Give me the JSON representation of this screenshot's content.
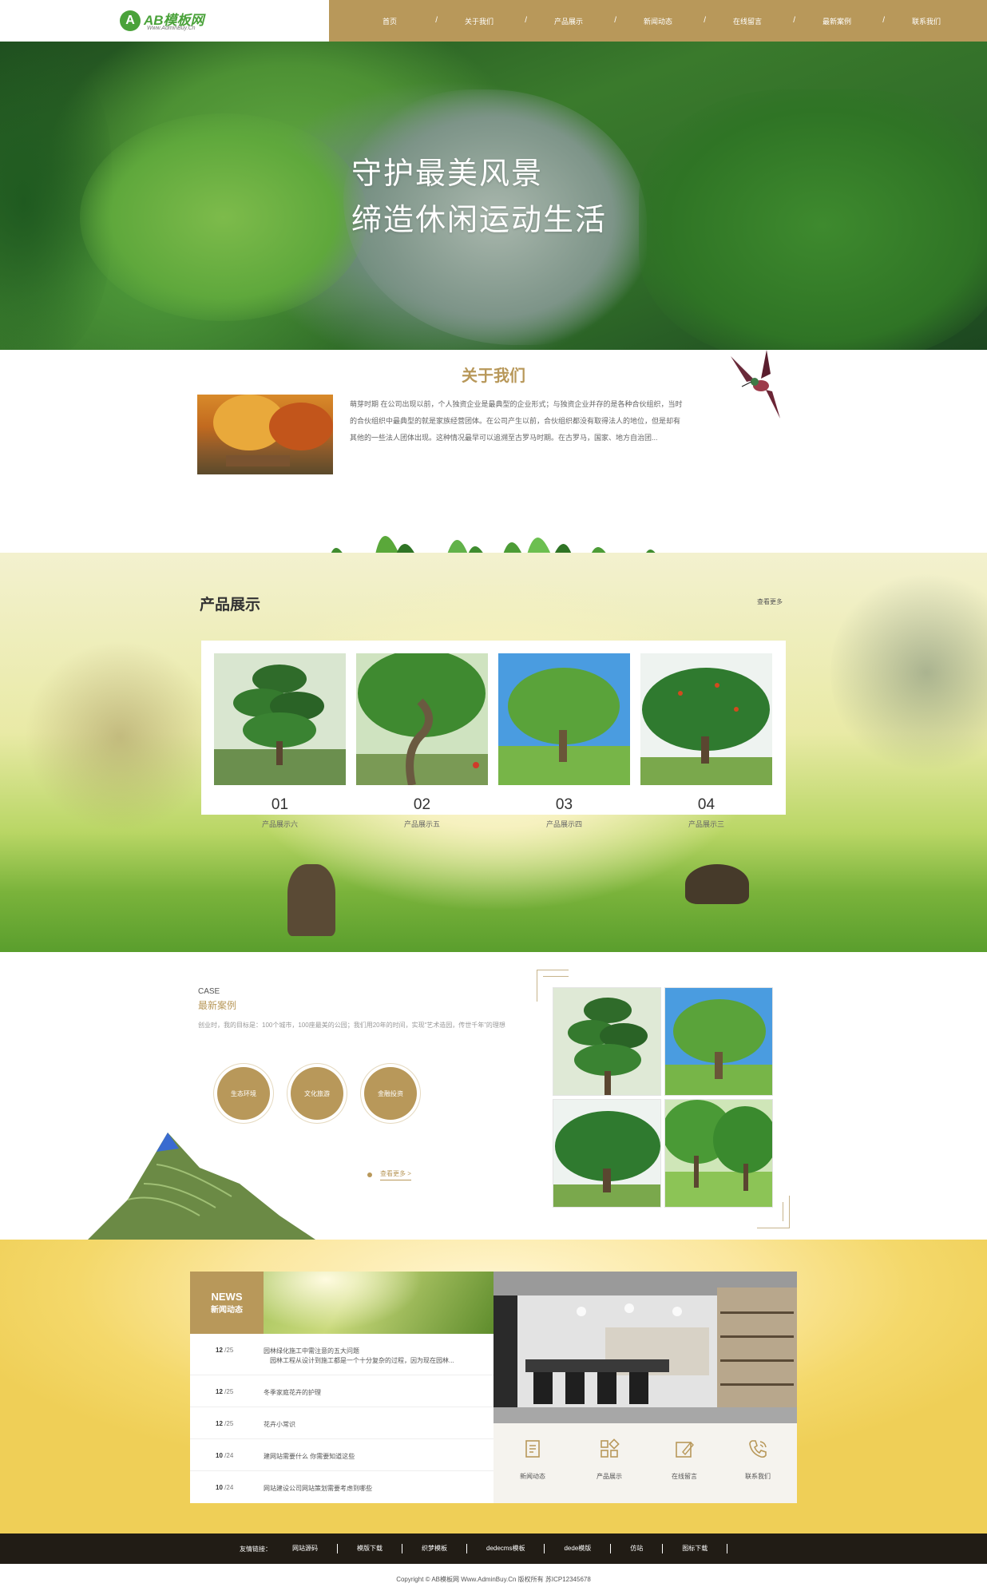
{
  "header": {
    "logo_mark": "A",
    "logo_text": "AB模板网",
    "logo_sub": "Www.AdminBuy.Cn",
    "accent": "#b8985a",
    "nav": [
      "首页",
      "关于我们",
      "产品展示",
      "新闻动态",
      "在线留言",
      "最新案例",
      "联系我们"
    ]
  },
  "hero": {
    "line1": "守护最美风景",
    "line2": "缔造休闲运动生活",
    "dots": 2,
    "active_dot": 1
  },
  "about": {
    "title": "关于我们",
    "text": "萌芽时期 在公司出现以前，个人独资企业是最典型的企业形式；与独资企业并存的是各种合伙组织，当时的合伙组织中最典型的就是家族经营团体。在公司产生以前，合伙组织都没有取得法人的地位，但是却有其他的一些法人团体出现。这种情况最早可以追溯至古罗马时期。在古罗马，国家、地方自治团..."
  },
  "products": {
    "title": "产品展示",
    "more": "查看更多",
    "items": [
      {
        "num": "01",
        "label": "产品展示六"
      },
      {
        "num": "02",
        "label": "产品展示五"
      },
      {
        "num": "03",
        "label": "产品展示四"
      },
      {
        "num": "04",
        "label": "产品展示三"
      }
    ]
  },
  "cases": {
    "en": "CASE",
    "cn": "最新案例",
    "desc": "创业时，我的目标是：100个城市，100座最美的公园；我们用20年的时间，实现“艺术造园，传世千年”的理想",
    "circles": [
      "生态环境",
      "文化旅游",
      "金融投资"
    ],
    "more": "查看更多 >"
  },
  "news": {
    "badge_en": "NEWS",
    "badge_cn": "新闻动态",
    "items": [
      {
        "day": "12",
        "month": "/25",
        "title": "园林绿化施工中需注意的五大问题",
        "sub": "园林工程从设计到施工都是一个十分复杂的过程，因为现在园林..."
      },
      {
        "day": "12",
        "month": "/25",
        "title": "冬季家庭花卉的护理",
        "sub": ""
      },
      {
        "day": "12",
        "month": "/25",
        "title": "花卉小常识",
        "sub": ""
      },
      {
        "day": "10",
        "month": "/24",
        "title": "建网站需要什么 你需要知道这些",
        "sub": ""
      },
      {
        "day": "10",
        "month": "/24",
        "title": "网站建设公司网站策划需要考虑到哪些",
        "sub": ""
      }
    ],
    "quick": [
      {
        "icon": "document-icon",
        "label": "新闻动态"
      },
      {
        "icon": "grid-icon",
        "label": "产品展示"
      },
      {
        "icon": "edit-icon",
        "label": "在线留言"
      },
      {
        "icon": "phone-icon",
        "label": "联系我们"
      }
    ]
  },
  "footer": {
    "links_label": "友情链接：",
    "links": [
      "网站源码",
      "模版下载",
      "织梦模板",
      "dedecms模板",
      "dede模版",
      "仿站",
      "图标下载"
    ],
    "copyright": "Copyright © AB模板网 Www.AdminBuy.Cn 版权所有   苏ICP12345678"
  }
}
